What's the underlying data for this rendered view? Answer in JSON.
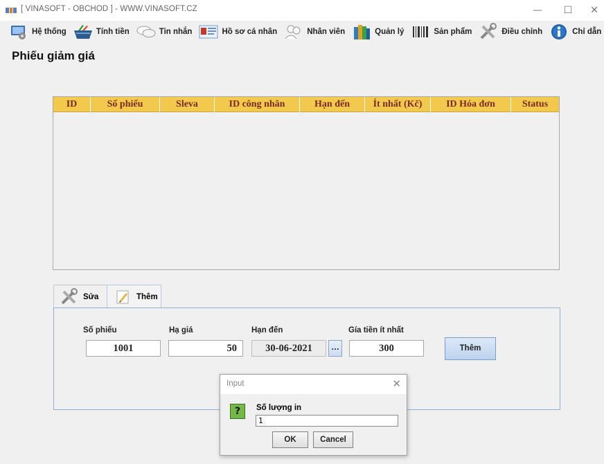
{
  "window": {
    "title": "[ VINASOFT - OBCHOD ] - WWW.VINASOFT.CZ",
    "minimize": "—",
    "maximize": "☐",
    "close": "✕"
  },
  "menu": [
    {
      "label": "Hệ thống",
      "icon": "system-icon"
    },
    {
      "label": "Tính tiền",
      "icon": "cart-icon"
    },
    {
      "label": "Tin nhắn",
      "icon": "chat-icon"
    },
    {
      "label": "Hồ sơ cá nhân",
      "icon": "profile-card-icon"
    },
    {
      "label": "Nhân viên",
      "icon": "people-icon"
    },
    {
      "label": "Quản lý",
      "icon": "books-icon"
    },
    {
      "label": "Sản phẩm",
      "icon": "barcode-icon"
    },
    {
      "label": "Điều chỉnh",
      "icon": "tools-icon"
    },
    {
      "label": "Chỉ dẫn",
      "icon": "info-icon"
    }
  ],
  "page": {
    "title": "Phiếu giảm giá"
  },
  "table": {
    "columns": [
      "ID",
      "Số phiếu",
      "Sleva",
      "ID công nhân",
      "Hạn đến",
      "Ít nhất (Kč)",
      "ID Hóa đơn",
      "Status"
    ],
    "rows": []
  },
  "tabs": [
    {
      "label": "Sửa",
      "icon": "tools-icon",
      "active": false
    },
    {
      "label": "Thêm",
      "icon": "edit-icon",
      "active": true
    }
  ],
  "form": {
    "so_phieu": {
      "label": "Số phiếu",
      "value": "1001"
    },
    "ha_gia": {
      "label": "Hạ giá",
      "value": "50"
    },
    "han_den": {
      "label": "Hạn đến",
      "value": "30-06-2021",
      "picker": "..."
    },
    "gia_tien": {
      "label": "Gía tiền ít nhất",
      "value": "300"
    },
    "submit_label": "Thêm"
  },
  "dialog": {
    "title": "Input",
    "close": "✕",
    "question_mark": "?",
    "label": "Số lượng in",
    "value": "1",
    "ok_label": "OK",
    "cancel_label": "Cancel"
  }
}
